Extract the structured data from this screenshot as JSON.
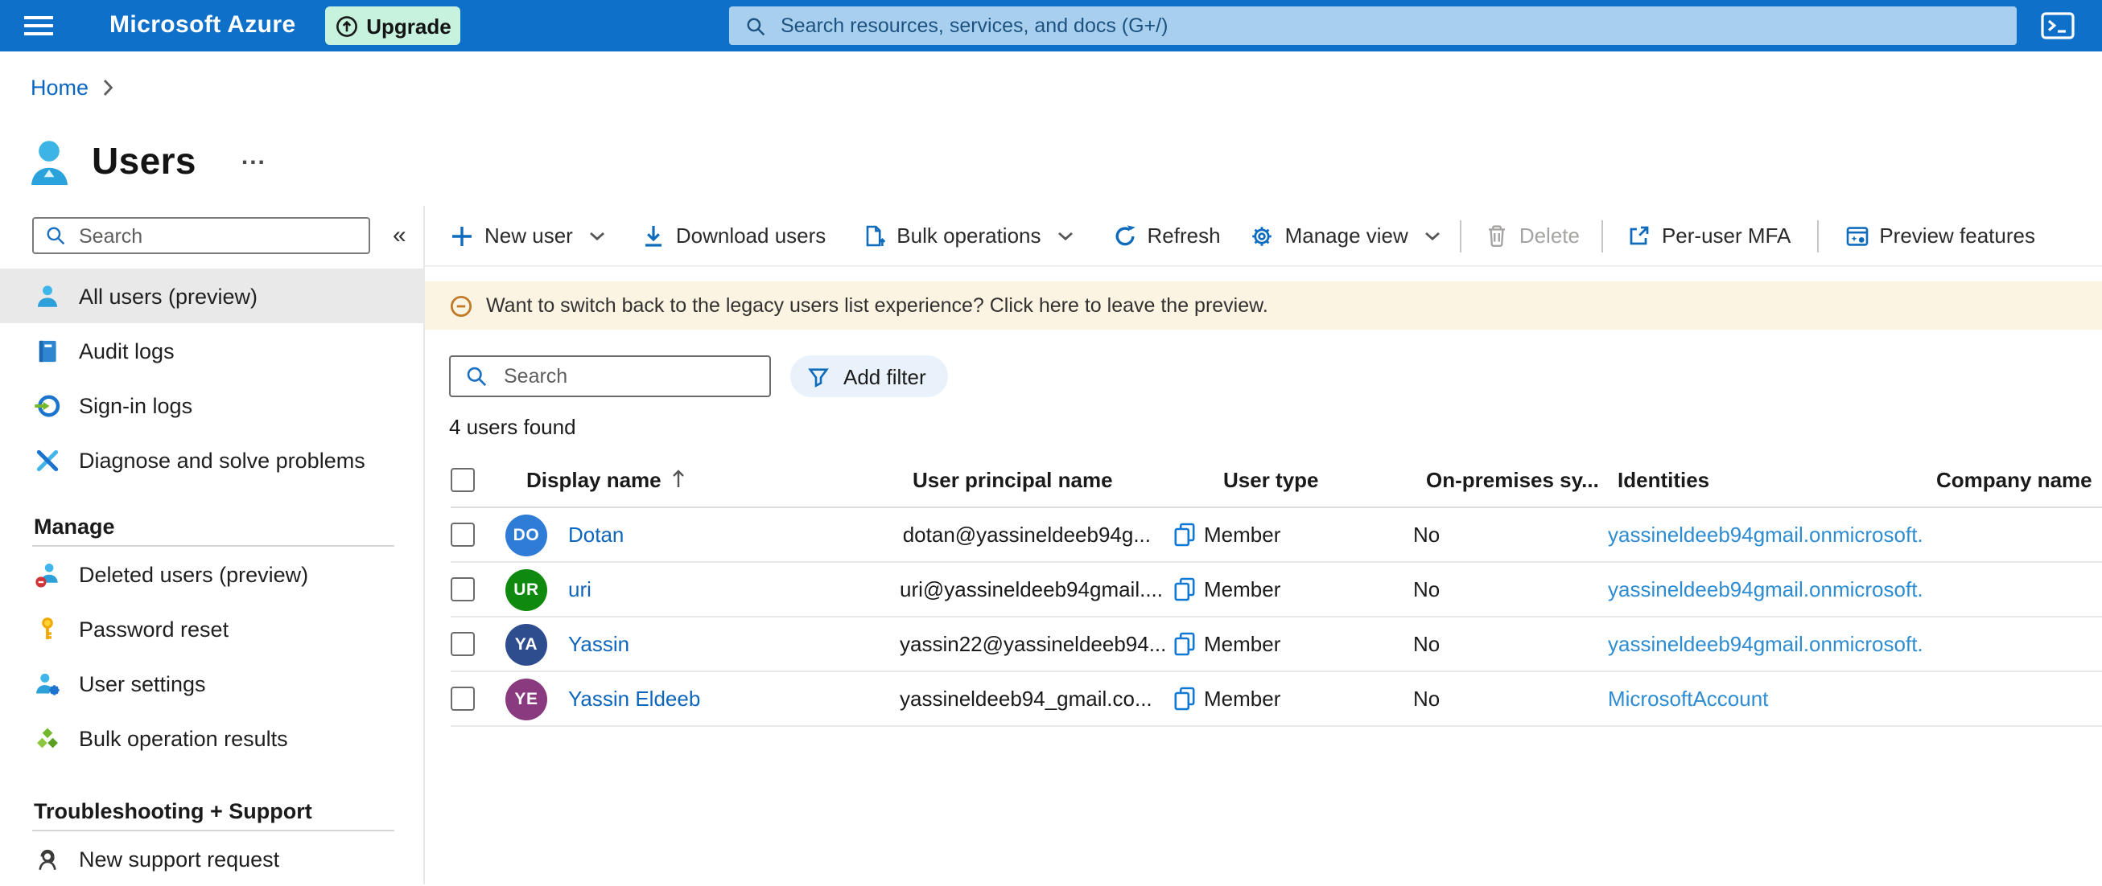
{
  "topbar": {
    "brand": "Microsoft Azure",
    "upgrade_label": "Upgrade",
    "search_placeholder": "Search resources, services, and docs (G+/)"
  },
  "breadcrumb": {
    "home": "Home"
  },
  "page": {
    "title": "Users",
    "overflow": "..."
  },
  "sidebar": {
    "search_placeholder": "Search",
    "collapse": "«",
    "items": [
      {
        "label": "All users (preview)"
      },
      {
        "label": "Audit logs"
      },
      {
        "label": "Sign-in logs"
      },
      {
        "label": "Diagnose and solve problems"
      }
    ],
    "manage": {
      "heading": "Manage",
      "items": [
        {
          "label": "Deleted users (preview)"
        },
        {
          "label": "Password reset"
        },
        {
          "label": "User settings"
        },
        {
          "label": "Bulk operation results"
        }
      ]
    },
    "support": {
      "heading": "Troubleshooting + Support",
      "items": [
        {
          "label": "New support request"
        }
      ]
    }
  },
  "toolbar": {
    "new_user": "New user",
    "download_users": "Download users",
    "bulk_operations": "Bulk operations",
    "refresh": "Refresh",
    "manage_view": "Manage view",
    "delete": "Delete",
    "per_user_mfa": "Per-user MFA",
    "preview_features": "Preview features"
  },
  "banner": {
    "message": "Want to switch back to the legacy users list experience? Click here to leave the preview."
  },
  "filters": {
    "search_placeholder": "Search",
    "add_filter": "Add filter"
  },
  "results": {
    "count": "4 users found"
  },
  "table": {
    "columns": [
      "Display name",
      "User principal name",
      "User type",
      "On-premises sy...",
      "Identities",
      "Company name"
    ],
    "rows": [
      {
        "initials": "DO",
        "avatar_color": "#2e7cd6",
        "name": "Dotan",
        "upn": "dotan@yassineldeeb94g...",
        "user_type": "Member",
        "on_premises": "No",
        "identities": "yassineldeeb94gmail.onmicrosoft.",
        "company": ""
      },
      {
        "initials": "UR",
        "avatar_color": "#0f8a0f",
        "name": "uri",
        "upn": "uri@yassineldeeb94gmail....",
        "user_type": "Member",
        "on_premises": "No",
        "identities": "yassineldeeb94gmail.onmicrosoft.",
        "company": ""
      },
      {
        "initials": "YA",
        "avatar_color": "#2e4d8f",
        "name": "Yassin",
        "upn": "yassin22@yassineldeeb94...",
        "user_type": "Member",
        "on_premises": "No",
        "identities": "yassineldeeb94gmail.onmicrosoft.",
        "company": ""
      },
      {
        "initials": "YE",
        "avatar_color": "#8a3b80",
        "name": "Yassin Eldeeb",
        "upn": "yassineldeeb94_gmail.co...",
        "user_type": "Member",
        "on_premises": "No",
        "identities": "MicrosoftAccount",
        "company": ""
      }
    ]
  },
  "colors": {
    "header_blue": "#0e70c8",
    "accent_blue": "#0f6cbd",
    "link_blue": "#0e66bc",
    "identity_link_blue": "#2e8cd2",
    "banner_bg": "#fbf4e3",
    "banner_icon_orange": "#c07a28",
    "upgrade_mint": "#c6f2de",
    "selected_item_bg": "#e9e9e9"
  }
}
